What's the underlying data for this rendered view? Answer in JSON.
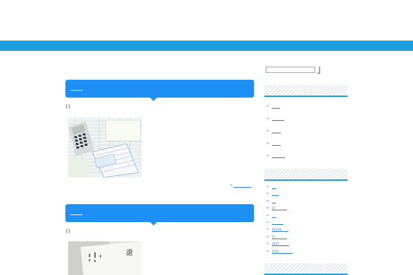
{
  "posts": [
    {
      "title": "",
      "marker": "[]",
      "image": "calculator-and-tax-forms-photo"
    },
    {
      "title": "",
      "marker": "[]",
      "image": "envelope-document-photo"
    }
  ],
  "post_more_label": "",
  "search": {
    "placeholder": "",
    "value": ""
  },
  "sidebar": {
    "widgets": [
      {
        "title": "",
        "items": [
          "",
          "",
          "",
          "",
          ""
        ]
      },
      {
        "title": "",
        "items": [
          "",
          "",
          "",
          "27",
          "",
          "",
          "2015年",
          "27",
          "2015",
          "2015"
        ]
      },
      {
        "title": ""
      }
    ]
  },
  "colors": {
    "accent": "#1a9fe0",
    "post_header": "#1e8ff5",
    "link": "#1a7de0"
  }
}
